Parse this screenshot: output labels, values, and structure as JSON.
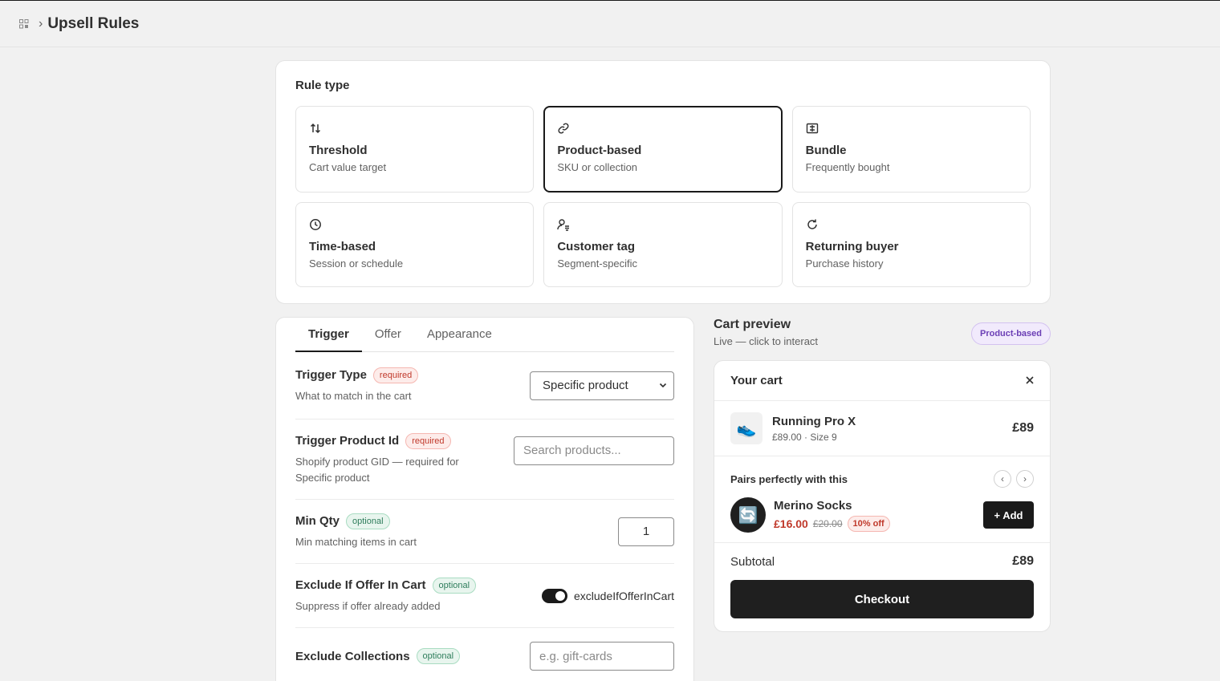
{
  "header": {
    "app_icon": "apps-grid-icon",
    "separator": "›",
    "title": "Upsell Rules"
  },
  "rule_type": {
    "title": "Rule type",
    "selected": "Product-based",
    "options": [
      {
        "icon": "arrows-up-down-icon",
        "title": "Threshold",
        "subtitle": "Cart value target"
      },
      {
        "icon": "link-icon",
        "title": "Product-based",
        "subtitle": "SKU or collection"
      },
      {
        "icon": "bundle-box-icon",
        "title": "Bundle",
        "subtitle": "Frequently bought"
      },
      {
        "icon": "clock-icon",
        "title": "Time-based",
        "subtitle": "Session or schedule"
      },
      {
        "icon": "customer-tag-icon",
        "title": "Customer tag",
        "subtitle": "Segment-specific"
      },
      {
        "icon": "refresh-icon",
        "title": "Returning buyer",
        "subtitle": "Purchase history"
      }
    ]
  },
  "tabs": [
    "Trigger",
    "Offer",
    "Appearance"
  ],
  "active_tab": "Trigger",
  "fields": {
    "trigger_type": {
      "label": "Trigger Type",
      "badge": "required",
      "help": "What to match in the cart",
      "value": "Specific product"
    },
    "trigger_product": {
      "label": "Trigger Product Id",
      "badge": "required",
      "help": "Shopify product GID — required for Specific product",
      "placeholder": "Search products..."
    },
    "min_qty": {
      "label": "Min Qty",
      "badge": "optional",
      "help": "Min matching items in cart",
      "value": "1"
    },
    "exclude_offer": {
      "label": "Exclude If Offer In Cart",
      "badge": "optional",
      "help": "Suppress if offer already added",
      "toggle_label": "excludeIfOfferInCart",
      "toggle_on": true
    },
    "exclude_collections": {
      "label": "Exclude Collections",
      "badge": "optional",
      "placeholder": "e.g. gift-cards"
    }
  },
  "preview": {
    "title": "Cart preview",
    "subtitle": "Live — click to interact",
    "badge": "Product-based",
    "cart_title": "Your cart",
    "item": {
      "thumb": "👟",
      "name": "Running Pro X",
      "meta": "£89.00 · Size 9",
      "price": "£89"
    },
    "upsell": {
      "title": "Pairs perfectly with this",
      "thumb": "🔄",
      "name": "Merino Socks",
      "price": "£16.00",
      "old_price": "£20.00",
      "discount": "10% off",
      "add_label": "+ Add"
    },
    "subtotal_label": "Subtotal",
    "subtotal_value": "£89",
    "checkout_label": "Checkout"
  }
}
